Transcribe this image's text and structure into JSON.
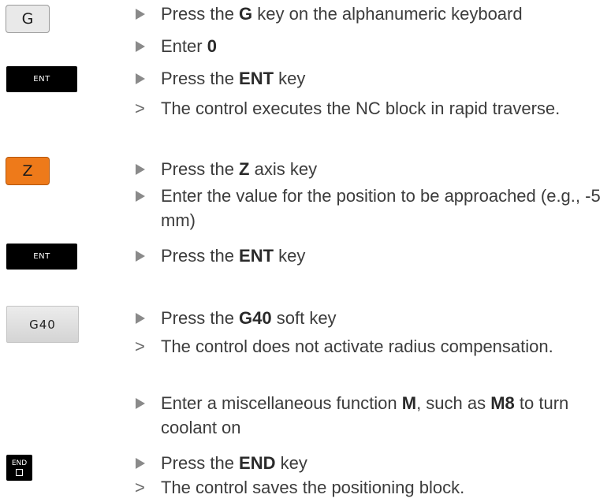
{
  "keys": {
    "g": "G",
    "ent1": "ENT",
    "z": "Z",
    "ent2": "ENT",
    "g40": "G40",
    "end": "END"
  },
  "colors": {
    "text": "#3c3c3c",
    "marker": "#8a8a8a",
    "z_key": "#ee7a1a",
    "ent_key": "#000000"
  },
  "steps": [
    {
      "type": "action",
      "pre": "Press the ",
      "bold": "G",
      "post": " key on the alphanumeric keyboard"
    },
    {
      "type": "action",
      "pre": "Enter ",
      "bold": "0",
      "post": ""
    },
    {
      "type": "action",
      "pre": "Press the ",
      "bold": "ENT",
      "post": " key"
    },
    {
      "type": "result",
      "text": "The control executes the NC block in rapid traverse."
    },
    {
      "type": "action",
      "pre": "Press the ",
      "bold": "Z",
      "post": " axis key"
    },
    {
      "type": "action",
      "text": "Enter the value for the position to be approached (e.g., -5 mm)"
    },
    {
      "type": "action",
      "pre": "Press the ",
      "bold": "ENT",
      "post": " key"
    },
    {
      "type": "action",
      "pre": "Press the ",
      "bold": "G40",
      "post": " soft key"
    },
    {
      "type": "result",
      "text": "The control does not activate radius compensation."
    },
    {
      "type": "action",
      "pre": "Enter a miscellaneous function ",
      "bold": "M",
      "mid": ", such as ",
      "bold2": "M8",
      "post": " to turn coolant on"
    },
    {
      "type": "action",
      "pre": "Press the ",
      "bold": "END",
      "post": " key"
    },
    {
      "type": "result",
      "text": "The control saves the positioning block."
    }
  ]
}
